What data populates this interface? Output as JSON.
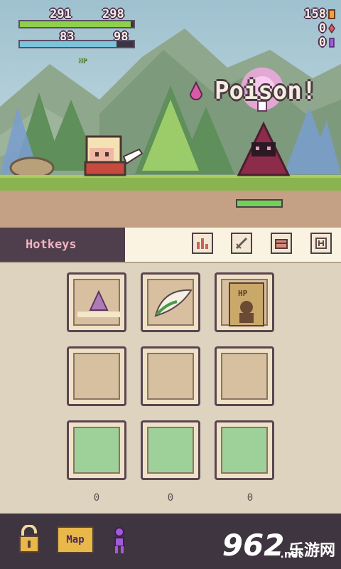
{
  "hud": {
    "hp_current": "291",
    "hp_max": "298",
    "hp_fraction": 0.976,
    "mp_current": "83",
    "mp_max": "98",
    "mp_fraction": 0.847,
    "hp_tag": "HP"
  },
  "currency": {
    "gold": "158",
    "gems_red": "0",
    "gems_purple": "0"
  },
  "battle": {
    "status_text": "Poison!",
    "enemy_hp_fraction": 1.0
  },
  "tabs": {
    "active_label": "Hotkeys",
    "icons": [
      "stats-icon",
      "sword-icon",
      "chest-icon",
      "help-icon"
    ]
  },
  "hotkeys": {
    "slots": [
      {
        "item": "poison-flask-icon",
        "state": "filled"
      },
      {
        "item": "green-leaf-icon",
        "state": "filled"
      },
      {
        "item": "hp-poster-icon",
        "state": "filled"
      },
      {
        "item": "",
        "state": "empty"
      },
      {
        "item": "",
        "state": "empty"
      },
      {
        "item": "",
        "state": "empty"
      },
      {
        "item": "",
        "state": "green"
      },
      {
        "item": "",
        "state": "green"
      },
      {
        "item": "",
        "state": "green"
      }
    ],
    "counts": [
      "0",
      "0",
      "0"
    ]
  },
  "bottombar": {
    "map_label": "Map",
    "watermark_number": "962",
    "watermark_cn": "乐游网",
    "watermark_net": ".net"
  },
  "colors": {
    "hp": "#8ecf4c",
    "mp": "#7cc4dc",
    "hotkeys_tab_bg": "#4f3e4c",
    "hotkeys_tab_text": "#f2b3c0"
  }
}
